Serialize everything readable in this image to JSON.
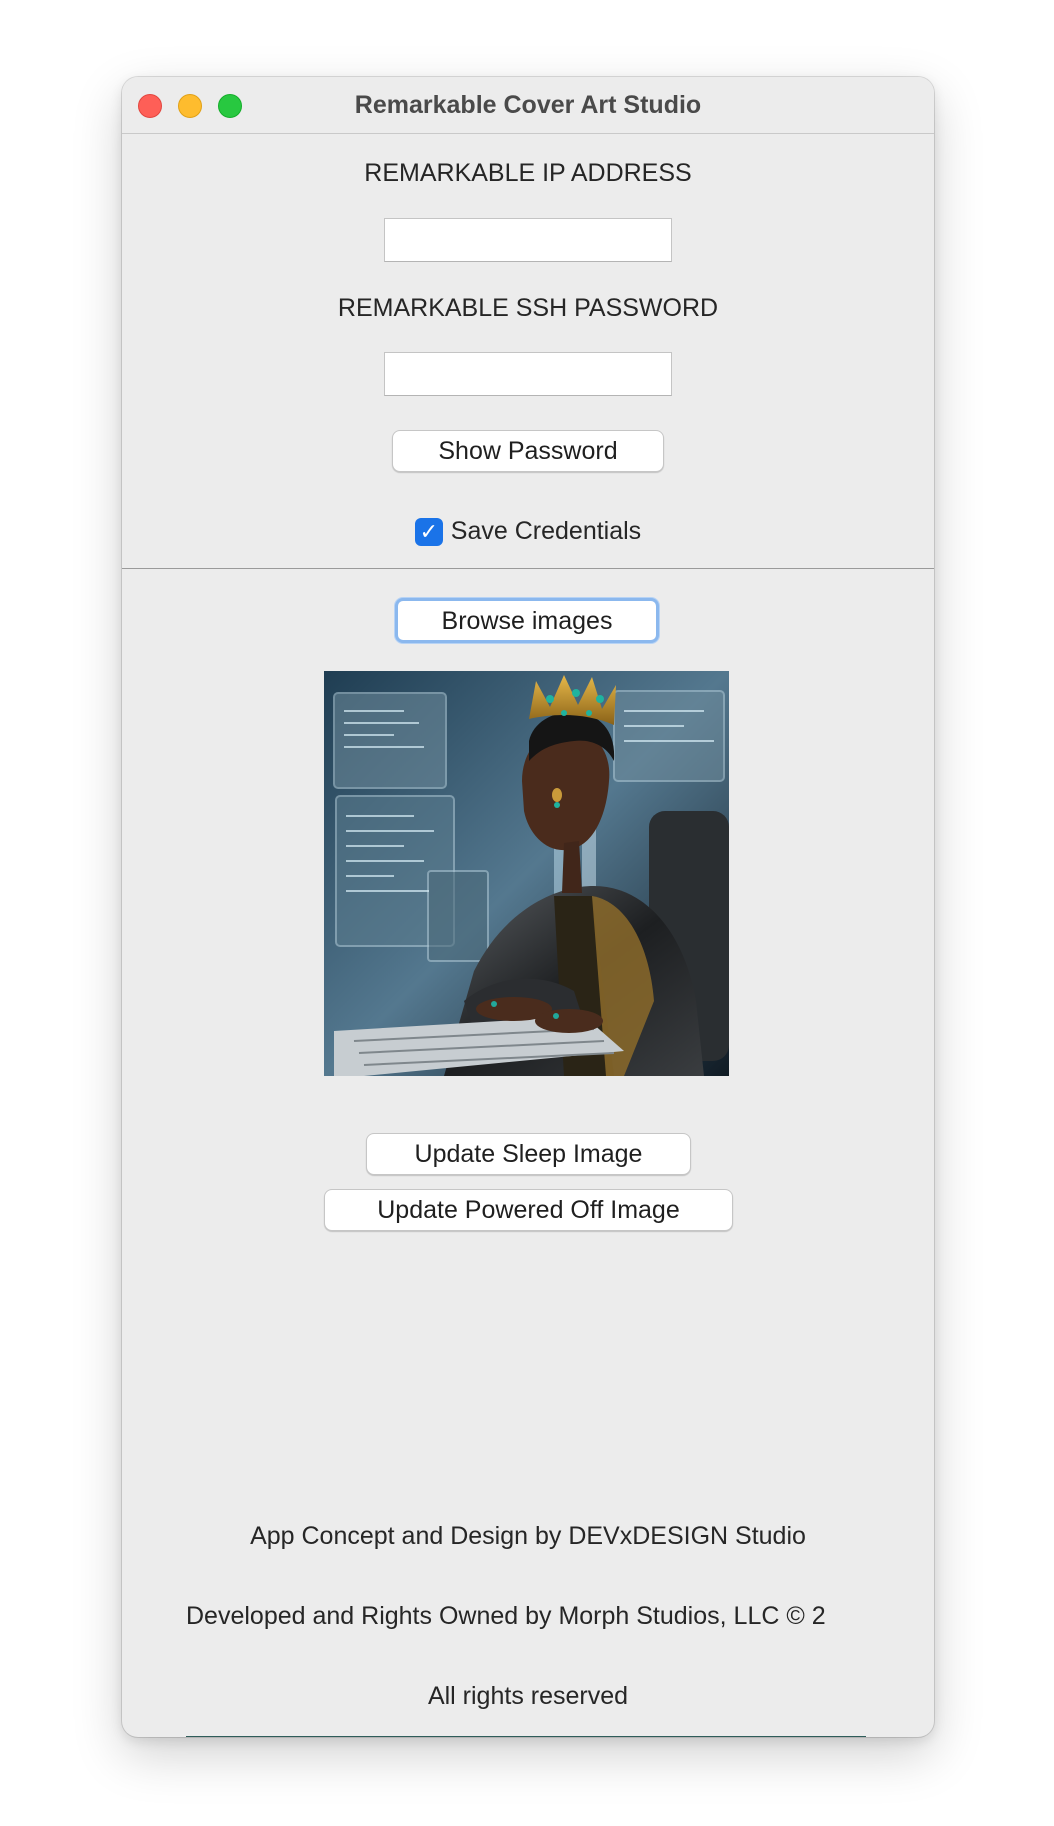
{
  "window": {
    "title": "Remarkable Cover Art Studio"
  },
  "credentials": {
    "ip_label": "REMARKABLE IP ADDRESS",
    "ip_value": "",
    "password_label": "REMARKABLE SSH PASSWORD",
    "password_value": "",
    "show_password_label": "Show Password",
    "save_credentials_label": "Save Credentials",
    "save_credentials_checked": true
  },
  "image": {
    "browse_label": "Browse images",
    "preview_icon": "cover-art-preview"
  },
  "actions": {
    "update_sleep_label": "Update Sleep Image",
    "update_powered_off_label": "Update Powered Off Image"
  },
  "footer": {
    "concept": "App Concept and Design by DEVxDESIGN Studio",
    "developed": "Developed and Rights Owned by Morph Studios, LLC © 2",
    "rights": "All rights reserved"
  },
  "colors": {
    "window_bg": "#ececec",
    "accent": "#1a73e8",
    "close": "#fe5f57",
    "minimize": "#febc2e",
    "maximize": "#28c840"
  }
}
